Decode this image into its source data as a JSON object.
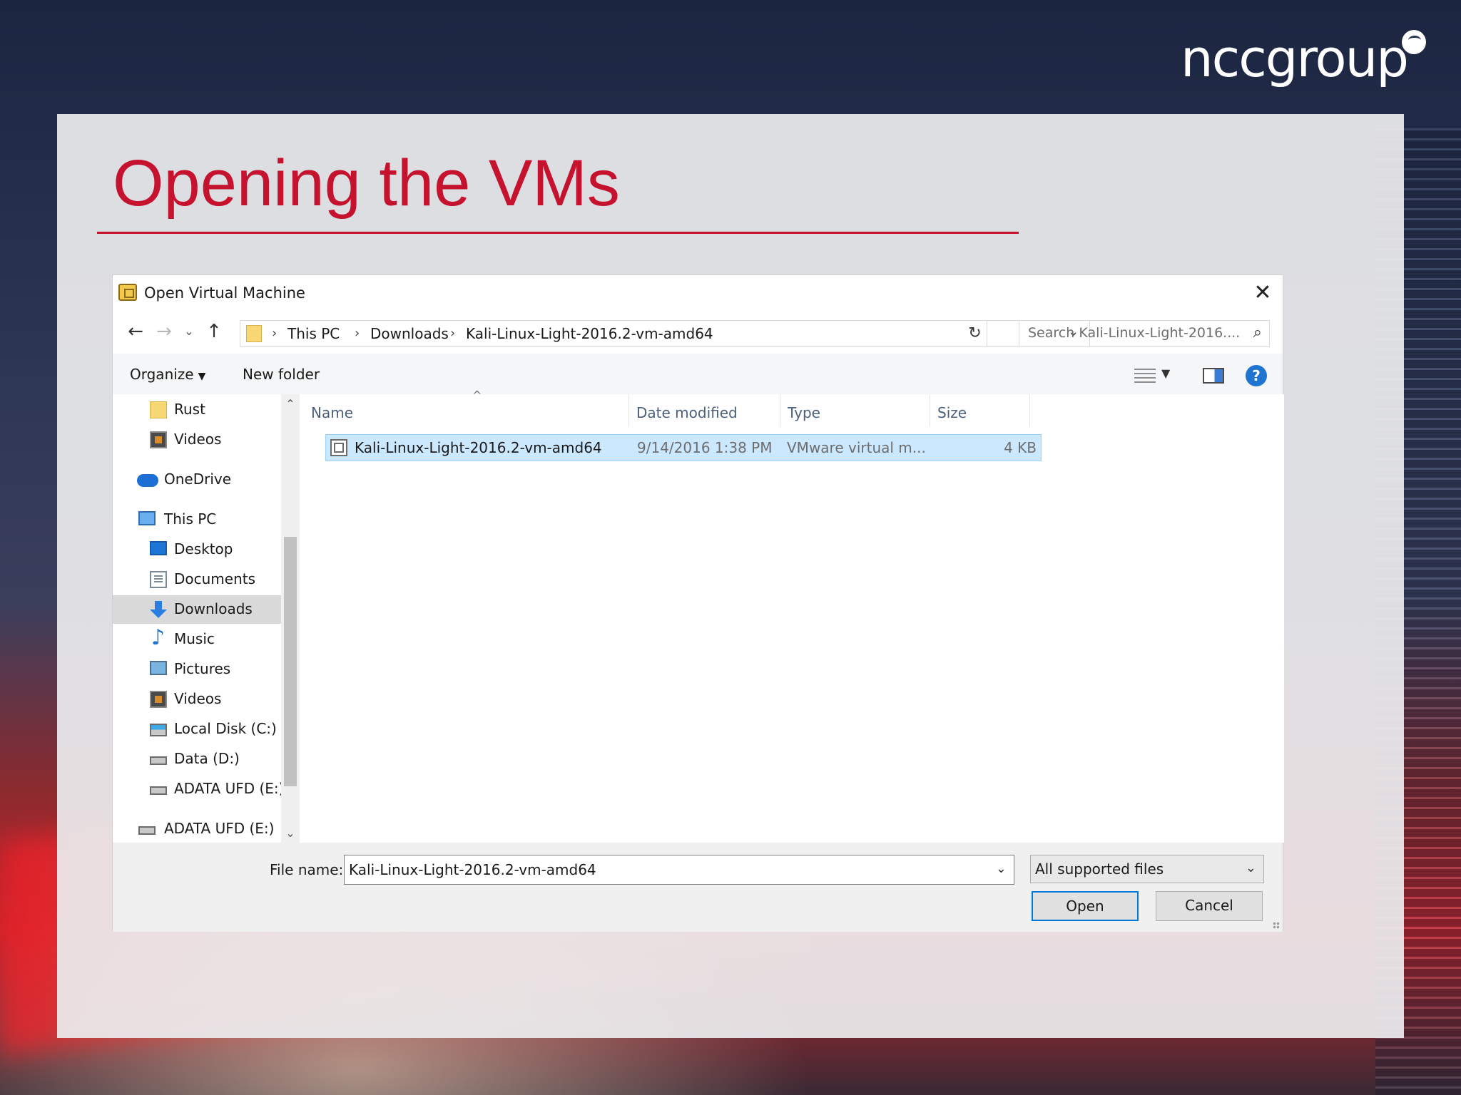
{
  "slide": {
    "title": "Opening the VMs",
    "logo": "nccgroup",
    "accent_color": "#c4122f"
  },
  "dialog": {
    "title": "Open Virtual Machine",
    "close_label": "✕",
    "nav": {
      "back": "←",
      "forward": "→",
      "recent": "⌄",
      "up": "↑"
    },
    "breadcrumb": [
      "This PC",
      "Downloads",
      "Kali-Linux-Light-2016.2-vm-amd64"
    ],
    "breadcrumb_sep": "›",
    "search_placeholder": "Search Kali-Linux-Light-2016....",
    "toolbar": {
      "organize": "Organize",
      "new_folder": "New folder",
      "help": "?"
    },
    "sidebar": [
      {
        "label": "Rust",
        "icon": "folder-icon"
      },
      {
        "label": "Videos",
        "icon": "videos-icon"
      },
      {
        "label": "OneDrive",
        "icon": "onedrive-icon"
      },
      {
        "label": "This PC",
        "icon": "this-pc-icon"
      },
      {
        "label": "Desktop",
        "icon": "desktop-icon"
      },
      {
        "label": "Documents",
        "icon": "documents-icon"
      },
      {
        "label": "Downloads",
        "icon": "downloads-icon",
        "selected": true
      },
      {
        "label": "Music",
        "icon": "music-icon"
      },
      {
        "label": "Pictures",
        "icon": "pictures-icon"
      },
      {
        "label": "Videos",
        "icon": "videos-icon"
      },
      {
        "label": "Local Disk (C:)",
        "icon": "local-disk-icon"
      },
      {
        "label": "Data (D:)",
        "icon": "drive-icon"
      },
      {
        "label": "ADATA UFD (E:)",
        "icon": "drive-icon"
      },
      {
        "label": "ADATA UFD (E:)",
        "icon": "drive-icon"
      }
    ],
    "columns": [
      "Name",
      "Date modified",
      "Type",
      "Size"
    ],
    "files": [
      {
        "name": "Kali-Linux-Light-2016.2-vm-amd64",
        "date_modified": "9/14/2016 1:38 PM",
        "type": "VMware virtual m...",
        "size": "4 KB",
        "selected": true
      }
    ],
    "file_name_label": "File name:",
    "file_name_value": "Kali-Linux-Light-2016.2-vm-amd64",
    "file_type_value": "All supported files",
    "open_label": "Open",
    "cancel_label": "Cancel"
  }
}
